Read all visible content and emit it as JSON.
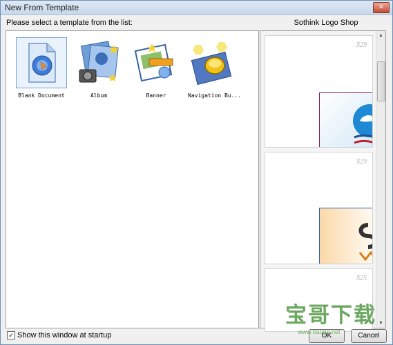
{
  "window": {
    "title": "New From Template",
    "close_glyph": "✕"
  },
  "prompt": "Please select a template from the list:",
  "templates": [
    {
      "label": "Blank Document",
      "icon": "blank-document-icon"
    },
    {
      "label": "Album",
      "icon": "album-icon"
    },
    {
      "label": "Banner",
      "icon": "banner-icon"
    },
    {
      "label": "Navigation Bu...",
      "icon": "navigation-button-icon"
    }
  ],
  "shop": {
    "title": "Sothink Logo Shop",
    "items": [
      {
        "price": "$29"
      },
      {
        "price": "$29"
      },
      {
        "price": "$25"
      }
    ]
  },
  "footer": {
    "startup_label": "Show this window at startup",
    "startup_checked": true,
    "checkbox_glyph": "✓",
    "ok_label": "OK",
    "cancel_label": "Cancel"
  },
  "watermark": {
    "main": "宝哥下载",
    "sub": "www.baoge.net"
  },
  "scroll_glyphs": {
    "up": "▲",
    "down": "▼"
  }
}
